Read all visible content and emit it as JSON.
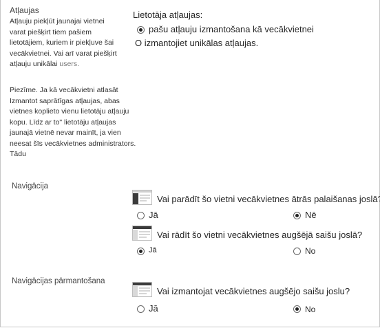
{
  "permissions": {
    "title": "Atļaujas",
    "desc1": "Atļauju piekļūt jaunajai vietnei varat piešķirt tiem pašiem lietotājiem, kuriem ir piekļuve šai vecākvietnei. Vai arī varat piešķirt atļauju unikālai",
    "desc1_tail": "users.",
    "desc2": "Piezīme. Ja kā vecākvietni atlasāt Izmantot saprātīgas atļaujas, abas vietnes koplieto vienu lietotāju atļauju kopu. Līdz ar to\" lietotāju atļaujas jaunajā vietnē nevar mainīt, ja vien neesat šīs vecākvietnes administrators. Tādu",
    "field_label": "Lietotāja atļaujas:",
    "option_same": "pašu atļauju izmantošana kā vecākvietnei",
    "option_same_selected": true,
    "option_unique": "O izmantojiet unikālas atļaujas."
  },
  "navigation": {
    "title": "Navigācija",
    "q1": "Vai parādīt šo vietni vecākvietnes ātrās palaišanas joslā?",
    "q1_yes": "Jā",
    "q1_no": "Nē",
    "q1_selected": "no",
    "q2": "Vai rādīt šo vietni vecākvietnes augšējā saišu joslā?",
    "q2_yes": "Jā",
    "q2_no": "No",
    "q2_selected": "yes"
  },
  "inheritance": {
    "title": "Navigācijas pārmantošana",
    "q": "Vai izmantojat vecākvietnes augšējo saišu joslu?",
    "yes": "Jā",
    "no": "No",
    "selected": "no"
  },
  "icons": {
    "quick_launch": "quick-launch-layout-icon",
    "top_link_bar": "top-link-bar-layout-icon"
  }
}
